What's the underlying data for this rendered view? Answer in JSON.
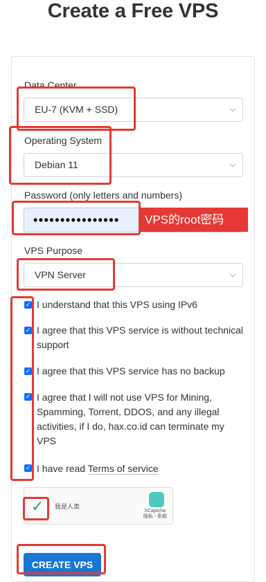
{
  "page": {
    "title": "Create a Free VPS"
  },
  "form": {
    "data_center": {
      "label": "Data Center",
      "value": "EU-7 (KVM + SSD)"
    },
    "os": {
      "label": "Operating System",
      "value": "Debian 11"
    },
    "password": {
      "label": "Password (only letters and numbers)",
      "value": "••••••••••••••••"
    },
    "annotation": "VPS的root密码",
    "purpose": {
      "label": "VPS Purpose",
      "value": "VPN Server"
    },
    "checkboxes": [
      "I understand that this VPS using IPv6",
      "I agree that this VPS service is without technical support",
      "I agree that this VPS service has no backup",
      "I agree that I will not use VPS for Mining, Spamming, Torrent, DDOS, and any illegal activities, if I do, hax.co.id can terminate my VPS",
      "I have read"
    ],
    "tos_link": "Terms of service",
    "captcha": {
      "text": "我是人类",
      "brand": "hCaptcha",
      "links": "隐私 - 条款"
    },
    "submit": "CREATE VPS"
  },
  "colors": {
    "accent": "#1976d2",
    "checkbox": "#0d6efd",
    "highlight": "#e53935"
  }
}
